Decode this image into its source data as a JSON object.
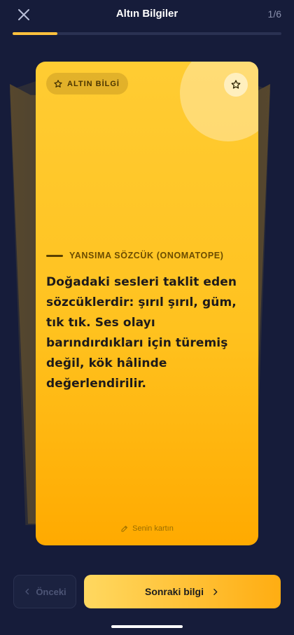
{
  "header": {
    "title": "Altın Bilgiler",
    "counter": "1/6",
    "progress": 0.166
  },
  "card": {
    "badge_label": "ALTIN BİLGİ",
    "category": "YANSIMA SÖZCÜK (ONOMATOPE)",
    "fact": "Doğadaki sesleri taklit eden sözcüklerdir: şırıl şırıl, güm, tık tık. Ses olayı barındırdıkları için türemiş değil, kök hâlinde değerlendirilir.",
    "author_label": "Senin kartın",
    "icons": {
      "badge": "star-outline-icon",
      "favorite": "star-outline-icon",
      "author": "pencil-icon"
    }
  },
  "footer": {
    "prev_label": "Önceki",
    "next_label": "Sonraki bilgi",
    "icons": {
      "prev": "chevron-left-icon",
      "next": "chevron-right-icon"
    }
  },
  "colors": {
    "background": "#161c3a",
    "accent": "#ffc13d",
    "card_top": "#ffcc33",
    "card_bottom": "#ffaa00"
  }
}
